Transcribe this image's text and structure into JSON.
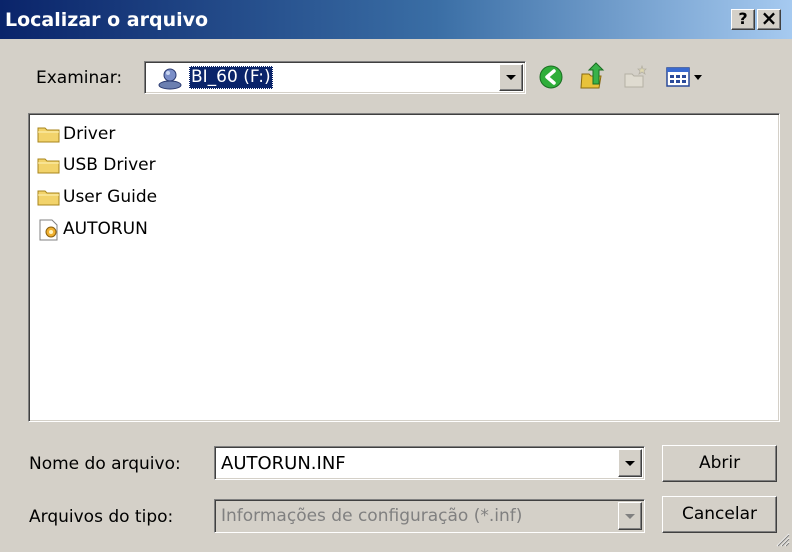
{
  "window": {
    "title": "Localizar o arquivo",
    "help_label": "?",
    "close_label": "×"
  },
  "toolbar": {
    "look_in_label": "Examinar:",
    "look_in_value": "BI_60 (F:)",
    "icons": [
      "back-icon",
      "up-folder-icon",
      "new-folder-icon",
      "view-menu-icon"
    ]
  },
  "files": [
    {
      "name": "Driver",
      "type": "folder"
    },
    {
      "name": "USB Driver",
      "type": "folder"
    },
    {
      "name": "User Guide",
      "type": "folder"
    },
    {
      "name": "AUTORUN",
      "type": "setup-file"
    }
  ],
  "filename": {
    "label": "Nome do arquivo:",
    "value": "AUTORUN.INF"
  },
  "filetype": {
    "label": "Arquivos do tipo:",
    "value": "Informações de configuração (*.inf)"
  },
  "buttons": {
    "open": "Abrir",
    "cancel": "Cancelar"
  },
  "colors": {
    "titlebar_start": "#0a246a",
    "titlebar_end": "#a6caf0",
    "face": "#d4d0c8",
    "selection": "#0a246a"
  }
}
